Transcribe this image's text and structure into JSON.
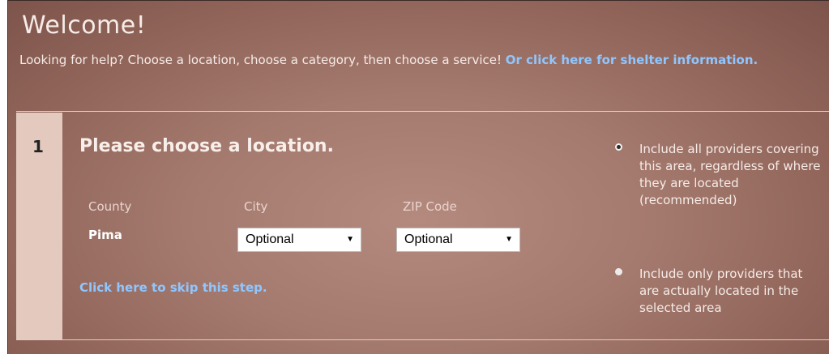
{
  "header": {
    "title": "Welcome!",
    "intro_text": "Looking for help? Choose a location, choose a category, then choose a service! ",
    "shelter_link": "Or click here for shelter information."
  },
  "step": {
    "number": "1",
    "title": "Please choose a location.",
    "county_label": "County",
    "county_value": "Pima",
    "city_label": "City",
    "city_value": "Optional",
    "zip_label": "ZIP Code",
    "zip_value": "Optional",
    "skip_link": "Click here to skip this step."
  },
  "options": [
    {
      "label": "Include all providers covering this area, regardless of where they are located (recommended)",
      "selected": true
    },
    {
      "label": "Include only providers that are actually located in the selected area",
      "selected": false
    }
  ],
  "colors": {
    "link": "#8fc6ff",
    "step_column": "#e3c9be",
    "panel": "#a57a6e"
  }
}
